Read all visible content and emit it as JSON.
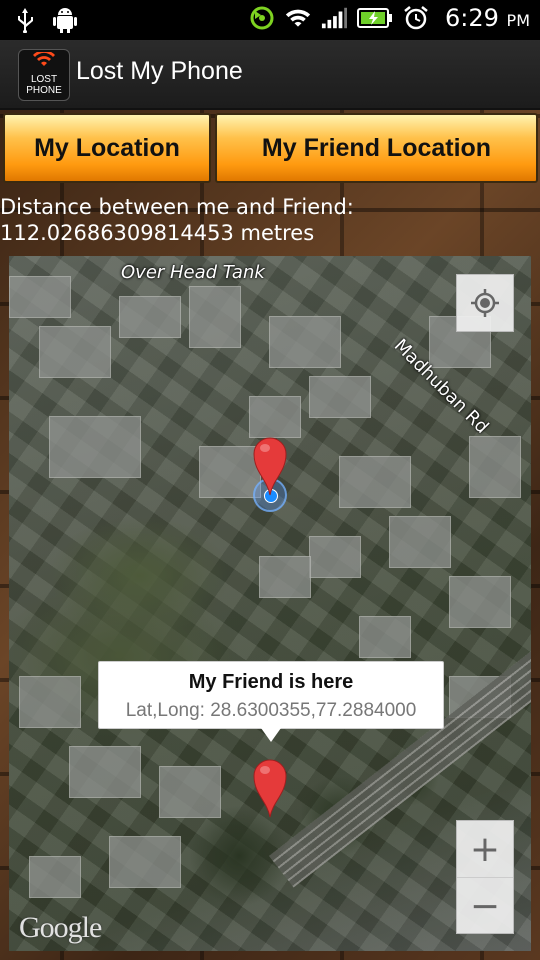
{
  "status_bar": {
    "time": "6:29",
    "ampm": "PM",
    "icons": [
      "usb-icon",
      "android-debug-icon",
      "sync-icon",
      "wifi-icon",
      "signal-icon",
      "battery-charging-icon",
      "alarm-icon"
    ]
  },
  "app": {
    "title": "Lost My Phone",
    "icon_text_line1": "LOST",
    "icon_text_line2": "PHONE"
  },
  "buttons": {
    "my_location": "My Location",
    "friend_location": "My Friend Location"
  },
  "distance": {
    "label": "Distance between me and Friend:",
    "value": "112.02686309814453 metres"
  },
  "map": {
    "labels": {
      "tank": "Over Head Tank",
      "road": "Madhuban Rd"
    },
    "info_window": {
      "title": "My Friend is here",
      "subtitle": "Lat,Long: 28.6300355,77.2884000"
    },
    "zoom_in": "+",
    "zoom_out": "−",
    "attribution": "Google",
    "pin_color": "#e53a3a"
  },
  "colors": {
    "button_top": "#fff3b0",
    "button_bottom": "#e07800",
    "my_location_dot": "#1a8cff"
  }
}
